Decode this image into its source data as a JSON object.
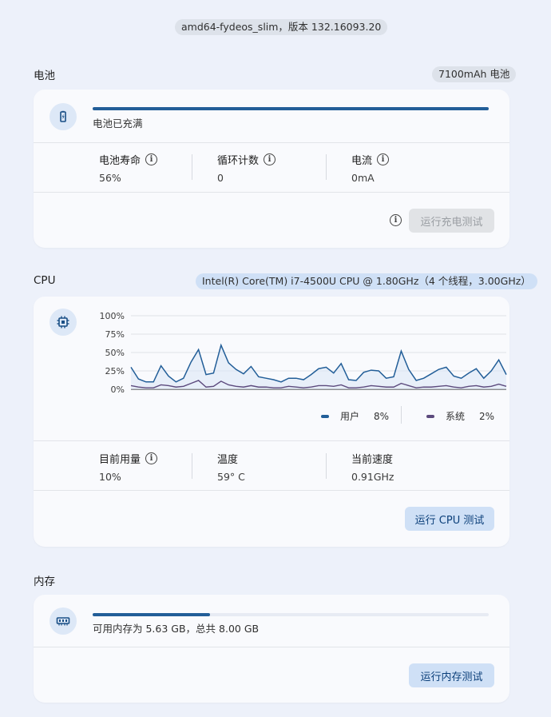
{
  "header": {
    "version": "amd64-fydeos_slim，版本 132.16093.20"
  },
  "battery": {
    "title": "电池",
    "capacity": "7100mAh 电池",
    "icon": "battery-charging-icon",
    "progress": 1.0,
    "status": "电池已充满",
    "stats": [
      {
        "label": "电池寿命",
        "value": "56%"
      },
      {
        "label": "循环计数",
        "value": "0"
      },
      {
        "label": "电流",
        "value": "0mA"
      }
    ],
    "test_button": "运行充电测试"
  },
  "cpu": {
    "title": "CPU",
    "model": "Intel(R) Core(TM) i7-4500U CPU @ 1.80GHz（4 个线程，3.00GHz）",
    "icon": "cpu-chip-icon",
    "legend": [
      {
        "label": "用户",
        "value": "8%",
        "color": "#225e98"
      },
      {
        "label": "系统",
        "value": "2%",
        "color": "#5c4a7d"
      }
    ],
    "stats": [
      {
        "label": "目前用量",
        "value": "10%"
      },
      {
        "label": "温度",
        "value": "59° C"
      },
      {
        "label": "当前速度",
        "value": "0.91GHz"
      }
    ],
    "test_button": "运行 CPU 测试"
  },
  "memory": {
    "title": "内存",
    "icon": "memory-module-icon",
    "progress": 0.296,
    "status": "可用内存为 5.63 GB，总共 8.00 GB",
    "test_button": "运行内存测试"
  },
  "chart_data": {
    "type": "line",
    "ylim": [
      0,
      100
    ],
    "yticks": [
      "100%",
      "75%",
      "50%",
      "25%",
      "0%"
    ],
    "grid": true,
    "series": [
      {
        "name": "用户",
        "color": "#225e98",
        "values": [
          30,
          14,
          10,
          10,
          32,
          18,
          10,
          15,
          37,
          54,
          20,
          22,
          60,
          36,
          27,
          21,
          31,
          17,
          15,
          13,
          10,
          15,
          15,
          13,
          20,
          28,
          30,
          22,
          35,
          13,
          12,
          23,
          26,
          25,
          15,
          17,
          52,
          27,
          12,
          15,
          21,
          27,
          30,
          18,
          15,
          22,
          28,
          15,
          25,
          40,
          20
        ]
      },
      {
        "name": "系统",
        "color": "#5c4a7d",
        "values": [
          5,
          3,
          2,
          2,
          6,
          5,
          3,
          4,
          8,
          12,
          3,
          4,
          11,
          6,
          4,
          3,
          5,
          3,
          3,
          2,
          2,
          4,
          3,
          2,
          3,
          5,
          5,
          4,
          6,
          2,
          2,
          3,
          5,
          4,
          3,
          3,
          8,
          5,
          2,
          3,
          3,
          4,
          5,
          3,
          2,
          4,
          5,
          3,
          4,
          7,
          4
        ]
      }
    ]
  }
}
